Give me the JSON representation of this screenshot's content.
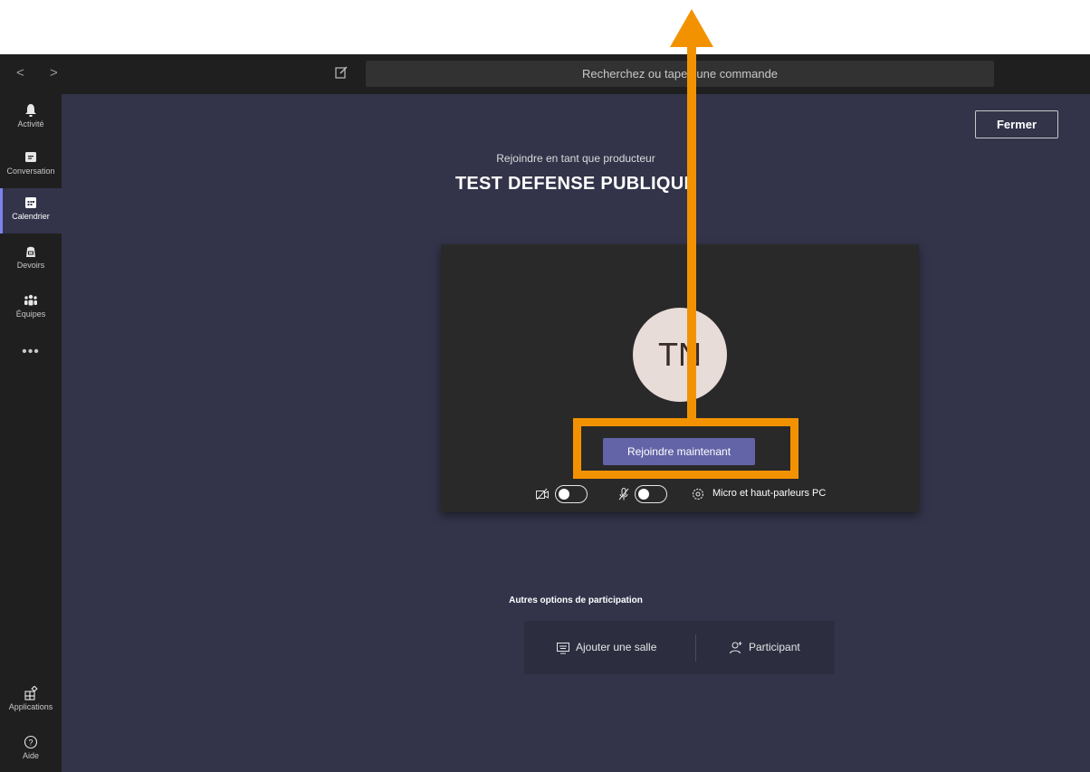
{
  "titlebar": {
    "nav_back": "<",
    "nav_forward": ">",
    "compose_icon": "compose-icon",
    "search_placeholder": "Recherchez ou tapez une commande"
  },
  "rail": {
    "items": [
      {
        "label": "Activité",
        "icon": "bell-icon"
      },
      {
        "label": "Conversation",
        "icon": "chat-icon"
      },
      {
        "label": "Calendrier",
        "icon": "calendar-icon",
        "active": true
      },
      {
        "label": "Devoirs",
        "icon": "backpack-icon"
      },
      {
        "label": "Équipes",
        "icon": "teams-icon"
      }
    ],
    "more": "•••",
    "bottom": [
      {
        "label": "Applications",
        "icon": "apps-icon"
      },
      {
        "label": "Aide",
        "icon": "help-icon"
      }
    ]
  },
  "main": {
    "close_label": "Fermer",
    "join_as": "Rejoindre en tant que producteur",
    "meeting_title": "TEST DEFENSE PUBLIQUE",
    "avatar_initials": "TN",
    "join_button": "Rejoindre maintenant",
    "device_label": "Micro et haut-parleurs PC",
    "camera_on": false,
    "mic_on": false,
    "other_options_title": "Autres options de participation",
    "other_options": [
      {
        "label": "Ajouter une salle",
        "icon": "room-icon"
      },
      {
        "label": "Participant",
        "icon": "add-person-icon"
      }
    ]
  },
  "colors": {
    "accent": "#6264a7",
    "annotation": "#f39200",
    "background": "#33344a",
    "chrome": "#1f1f1f"
  }
}
